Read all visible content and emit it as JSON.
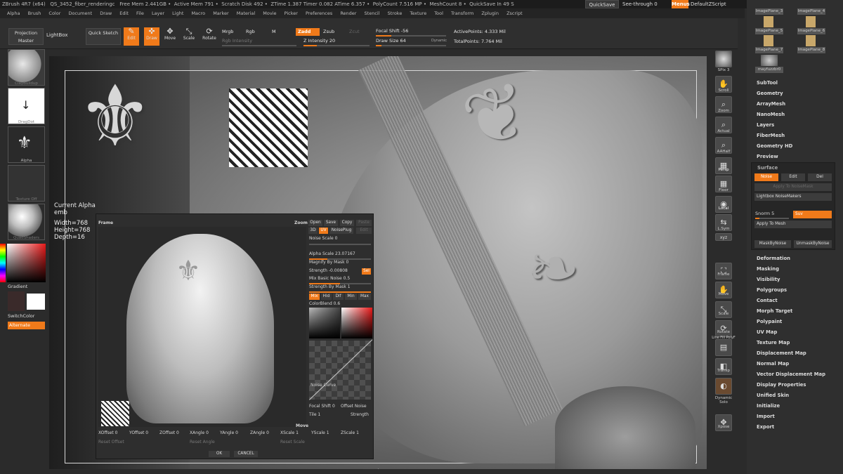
{
  "titlebar": {
    "app": "ZBrush 4R7 (x64)",
    "document": "QS_3452_fiber_renderingc",
    "free_mem": "Free Mem 2.441GB",
    "active_mem": "Active Mem 791",
    "scratch_disk": "Scratch Disk 492",
    "ztime": "ZTime 1.387 Timer 0.082 ATime 6.357",
    "polycount": "PolyCount 7.516 MP",
    "meshcount": "MeshCount 8",
    "quicksave_in": "QuickSave In 49 S",
    "quicksave_button": "QuickSave",
    "see_through": "See-through  0",
    "menus_button": "Menus",
    "default_script": "DefaultZScript"
  },
  "menubar": [
    "Alpha",
    "Brush",
    "Color",
    "Document",
    "Draw",
    "Edit",
    "File",
    "Layer",
    "Light",
    "Macro",
    "Marker",
    "Material",
    "Movie",
    "Picker",
    "Preferences",
    "Render",
    "Stencil",
    "Stroke",
    "Texture",
    "Tool",
    "Transform",
    "Zplugin",
    "Zscript"
  ],
  "toolbar": {
    "projection_master": "Projection Master",
    "lightbox": "LightBox",
    "quick_sketch": "Quick Sketch",
    "edit": "Edit",
    "draw": "Draw",
    "move": "Move",
    "scale": "Scale",
    "rotate": "Rotate",
    "mrgb": "Mrgb",
    "rgb": "Rgb",
    "m": "M",
    "zadd": "Zadd",
    "zsub": "Zsub",
    "zcut": "Zcut",
    "rgb_intensity": "Rgb Intensity",
    "z_intensity": "Z Intensity 20",
    "focal_shift": "Focal Shift -56",
    "draw_size": "Draw Size 64",
    "dynamic": "Dynamic",
    "active_points": "ActivePoints: 4.333 Mil",
    "total_points": "TotalPoints: 7.764 Mil"
  },
  "left_panel": {
    "brush_caption": "ClayBuildup",
    "stroke_caption": "DragDot",
    "alpha_caption": "Alpha",
    "texture_caption": "Texture Off",
    "material_caption": "QuadShaders",
    "gradient": "Gradient",
    "switch_color": "SwitchColor",
    "alternate": "Alternate"
  },
  "alpha_tooltip": {
    "title": "Current Alpha",
    "name": "emb",
    "width": "Width=768",
    "height": "Height=768",
    "depth": "Depth=16"
  },
  "right_shelf": [
    "SPix 3",
    "Scroll",
    "Zoom",
    "Actual",
    "AAHalf",
    "Persp",
    "Floor",
    "Local",
    "L.Sym",
    "xyz",
    "Frame",
    "Move",
    "Scale",
    "Rotate",
    "Line Fill PolyF",
    "Transp",
    "Dynamic Solo",
    "Xpose"
  ],
  "palette": {
    "thumbs": [
      "ImagePlane_3",
      "ImagePlane_4",
      "ImagePlane_5",
      "ImagePlane_6",
      "ImagePlane_7",
      "ImagePlane_8",
      "mayfuzzbr0"
    ],
    "items_top": [
      "SubTool",
      "Geometry",
      "ArrayMesh",
      "NanoMesh",
      "Layers",
      "FiberMesh",
      "Geometry HD",
      "Preview",
      "Surface"
    ],
    "noise": "Noise",
    "edit": "Edit",
    "del": "Del",
    "apply_noise_mask": "Apply To NoiseMask",
    "lightbox_noisemakers": "Lightbox NoiseMakers",
    "snorm": "Snorm 5",
    "suv": "Suv",
    "apply_to_mesh": "Apply To Mesh",
    "mask_by_noise": "MaskByNoise",
    "unmask_by_noise": "UnmaskByNoise",
    "items_bottom": [
      "Deformation",
      "Masking",
      "Visibility",
      "Polygroups",
      "Contact",
      "Morph Target",
      "Polypaint",
      "UV Map",
      "Texture Map",
      "Displacement Map",
      "Normal Map",
      "Vector Displacement Map",
      "Display Properties",
      "Unified Skin",
      "Initialize",
      "Import",
      "Export"
    ]
  },
  "dialog": {
    "frame": "Frame",
    "zoom": "Zoom",
    "open": "Open",
    "save": "Save",
    "copy": "Copy",
    "paste": "Paste",
    "3d": "3D",
    "uv": "UV",
    "noise_plug": "NoisePlug",
    "edit": "Edit",
    "noise_scale": "Noise Scale 0",
    "alpha_scale": "Alpha Scale 23.07167",
    "magnify_by_mask": "Magnify By Mask 0",
    "strength": "Strength -0.00808",
    "sel": "Sel",
    "mix_basic_noise": "Mix Basic Noise 0.5",
    "strength_by_mask": "Strength By Mask 1",
    "tabs": [
      "Mix",
      "Hid",
      "Dif",
      "Min",
      "Max"
    ],
    "color_blend": "ColorBlend 0.6",
    "noise_curve": "Noise Curve",
    "focal_shift": "Focal Shift 0",
    "offset_noise": "Offset Noise",
    "tile": "Tile 1",
    "strength2": "Strength",
    "move": "Move",
    "offsets": [
      "XOffset 0",
      "YOffset 0",
      "ZOffset 0",
      "XAngle 0",
      "YAngle 0",
      "ZAngle 0",
      "XScale 1",
      "YScale 1",
      "ZScale 1"
    ],
    "reset_offset": "Reset Offset",
    "reset_angle": "Reset Angle",
    "reset_scale": "Reset Scale",
    "ok": "OK",
    "cancel": "CANCEL"
  },
  "colors": {
    "accent": "#f07a1a",
    "bg": "#2b2b2b"
  }
}
